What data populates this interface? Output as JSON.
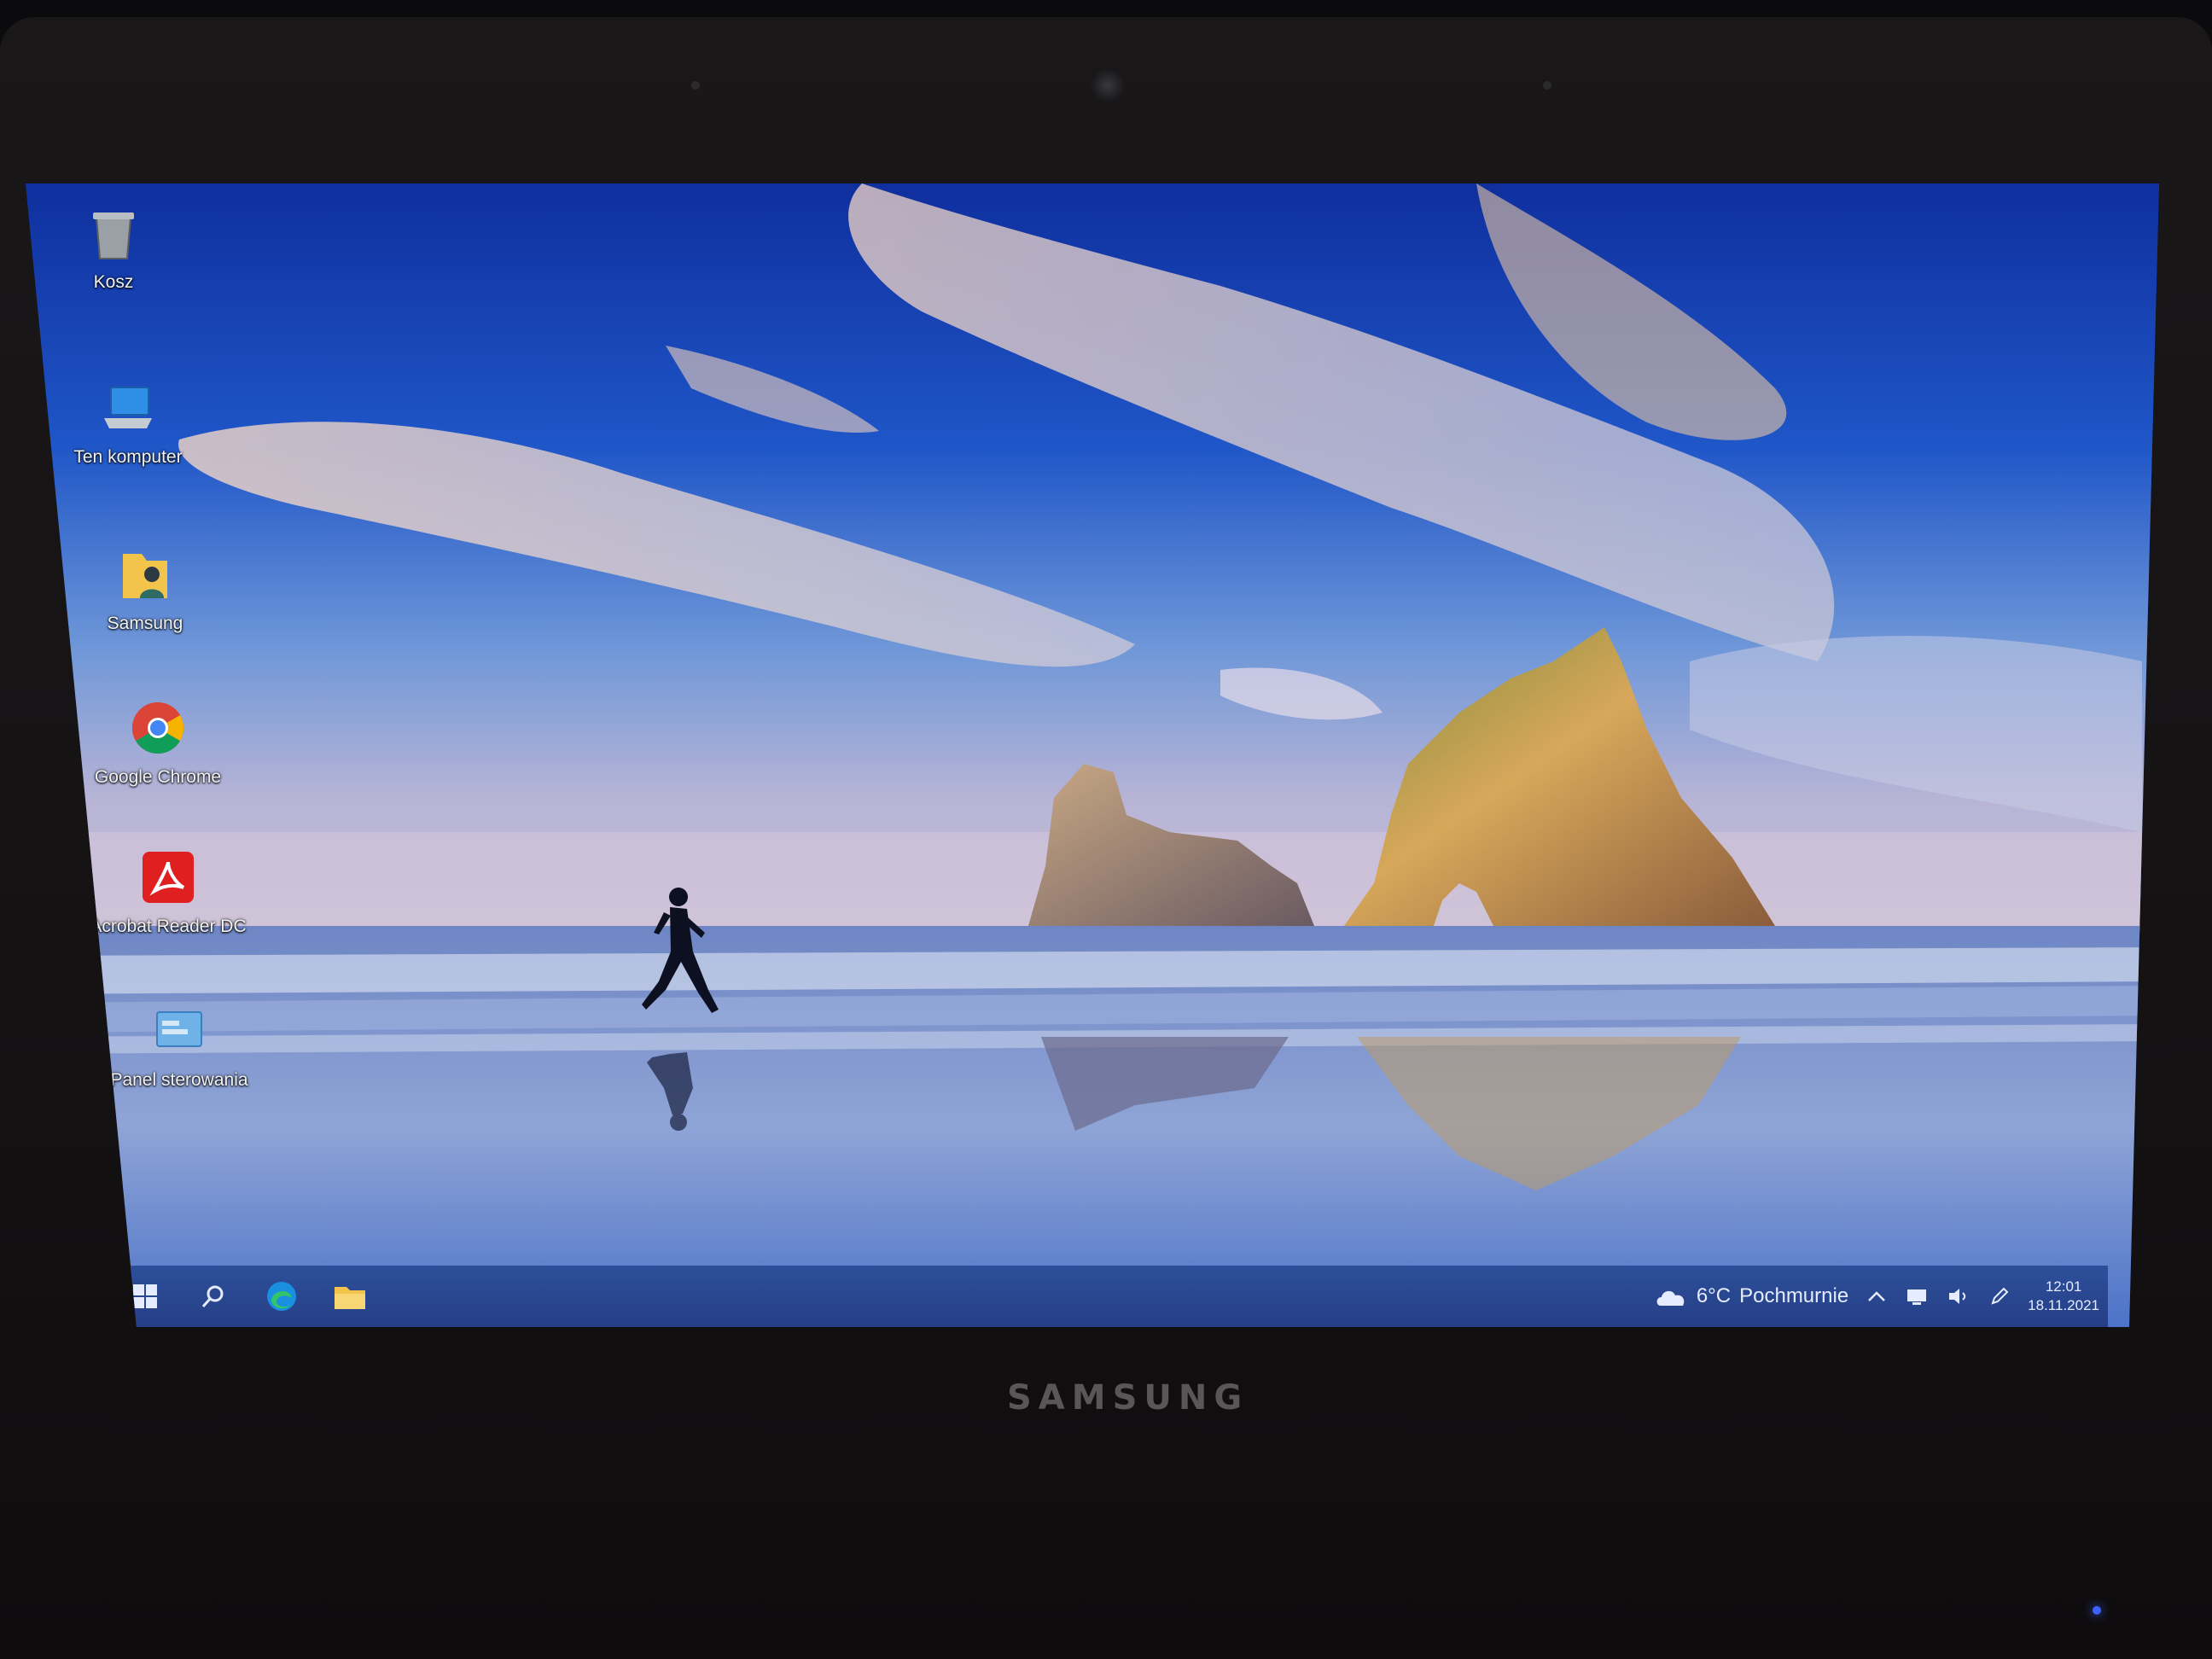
{
  "device": {
    "brand": "SAMSUNG"
  },
  "desktop": {
    "icons": [
      {
        "label": "Kosz",
        "icon": "recycle-bin-icon"
      },
      {
        "label": "Ten komputer",
        "icon": "this-pc-icon"
      },
      {
        "label": "Samsung",
        "icon": "user-folder-icon"
      },
      {
        "label": "Google Chrome",
        "icon": "chrome-icon"
      },
      {
        "label": "Acrobat Reader DC",
        "icon": "acrobat-reader-icon"
      },
      {
        "label": "Panel sterowania",
        "icon": "control-panel-icon"
      }
    ]
  },
  "taskbar": {
    "buttons": [
      {
        "icon": "windows-start-icon"
      },
      {
        "icon": "search-icon"
      },
      {
        "icon": "edge-browser-icon"
      },
      {
        "icon": "file-explorer-icon"
      }
    ],
    "weather": {
      "temperature": "6°C",
      "condition": "Pochmurnie",
      "icon": "cloud-icon"
    },
    "tray_icons": [
      "chevron-up-icon",
      "network-icon",
      "volume-icon",
      "pen-icon"
    ],
    "clock": {
      "time": "12:01",
      "date": "18.11.2021"
    }
  },
  "colors": {
    "taskbar": "#2a4891",
    "sky": "#1c44b4",
    "accent_edge": "#1a8fe0"
  }
}
